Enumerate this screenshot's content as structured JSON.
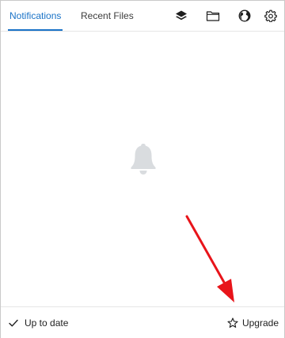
{
  "tabs": {
    "notifications": "Notifications",
    "recent_files": "Recent Files"
  },
  "header_icons": [
    "layers-icon",
    "folder-icon",
    "globe-icon",
    "gear-icon"
  ],
  "empty_state": {
    "icon": "bell-icon"
  },
  "footer": {
    "status_icon": "checkmark-icon",
    "status_text": "Up to date",
    "upgrade_icon": "star-icon",
    "upgrade_label": "Upgrade"
  },
  "colors": {
    "accent": "#1a73c7",
    "annotation_arrow": "#e8141a",
    "bell": "#d9dcdf"
  }
}
